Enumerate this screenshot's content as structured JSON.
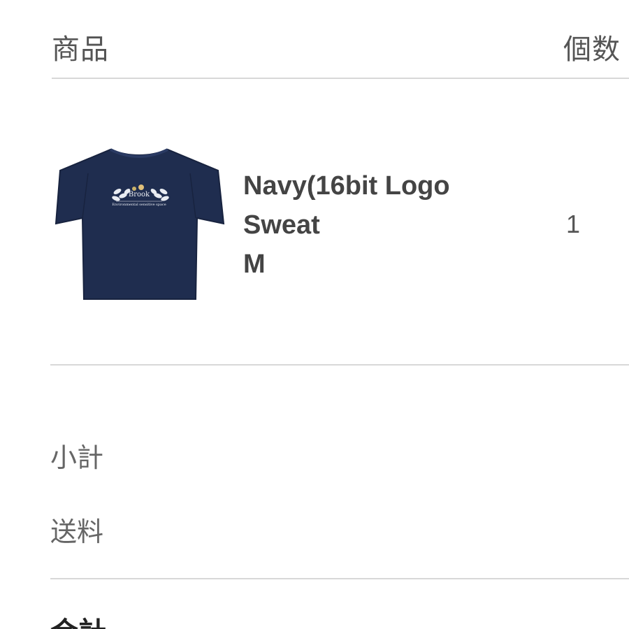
{
  "table": {
    "header_product": "商品",
    "header_quantity": "個数"
  },
  "item": {
    "name_line1": "Navy(16bit Logo",
    "name_line2": "Sweat",
    "name_line3": "M",
    "quantity": "1",
    "image_icon": "tshirt-product-image",
    "image_logo_text": "Brook",
    "image_tagline": "Environmental sensitive space"
  },
  "summary": {
    "subtotal_label": "小計",
    "shipping_label": "送料",
    "total_label": "合計"
  },
  "colors": {
    "shirt": "#1f2d4f",
    "divider": "#d8d8d8",
    "text": "#444444"
  }
}
